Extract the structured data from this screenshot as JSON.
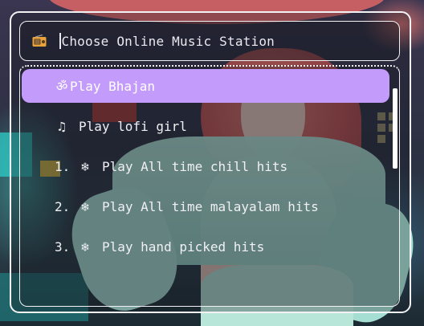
{
  "launcher": {
    "icon": "radio-icon",
    "prompt_placeholder": "Choose Online Music Station",
    "accent_color": "#c39bfb",
    "items": [
      {
        "prefix": "",
        "glyph": "ॐ",
        "label": "Play Bhajan",
        "selected": true
      },
      {
        "prefix": "",
        "glyph": "♫",
        "label": "Play lofi girl",
        "selected": false
      },
      {
        "prefix": "1.",
        "glyph": "❄",
        "label": "Play All time chill hits",
        "selected": false
      },
      {
        "prefix": "2.",
        "glyph": "❄",
        "label": "Play All time malayalam hits",
        "selected": false
      },
      {
        "prefix": "3.",
        "glyph": "❄",
        "label": "Play hand picked hits",
        "selected": false
      }
    ]
  }
}
